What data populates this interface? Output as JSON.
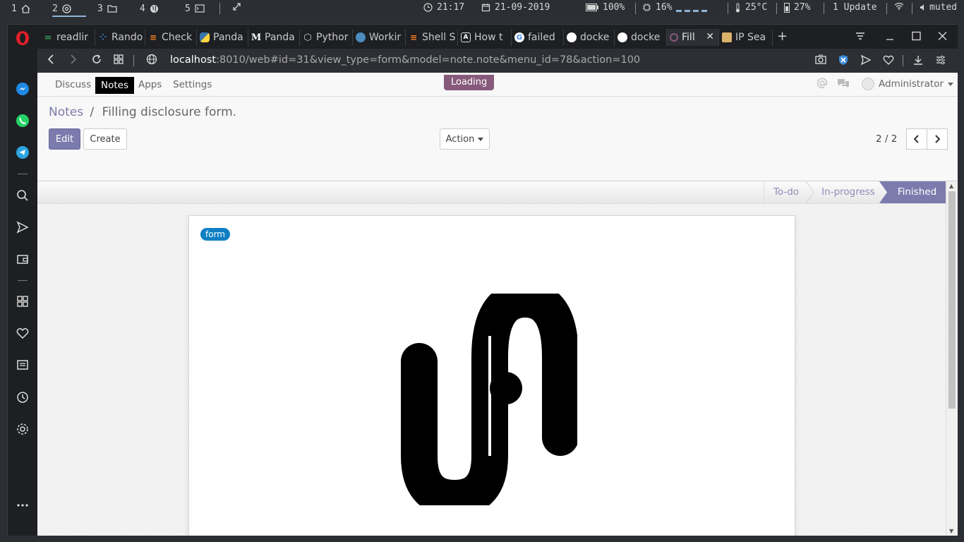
{
  "os_bar": {
    "workspaces": [
      {
        "num": "1",
        "icon": "home-icon"
      },
      {
        "num": "2",
        "icon": "chrome-icon"
      },
      {
        "num": "3",
        "icon": "folder-icon"
      },
      {
        "num": "4",
        "icon": "globe-icon"
      },
      {
        "num": "5",
        "icon": "terminal-icon"
      }
    ],
    "time": "21:17",
    "date": "21-09-2019",
    "battery": "100%",
    "cpu": "16%",
    "temp": "25°C",
    "disk": "27%",
    "updates": "1 Update",
    "volume": "muted"
  },
  "browser": {
    "tabs": [
      {
        "label": "readlir",
        "icon": "infinity-icon",
        "color": "#3a9e59"
      },
      {
        "label": "Rando",
        "icon": "grid-icon",
        "color": "#3c7fd1"
      },
      {
        "label": "Check",
        "icon": "stackoverflow-icon",
        "color": "#f48024"
      },
      {
        "label": "Panda",
        "icon": "python-icon",
        "color": "#f2c94c"
      },
      {
        "label": "Panda",
        "icon": "medium-icon",
        "color": "#ffffff"
      },
      {
        "label": "Pythor",
        "icon": "hexagon-icon",
        "color": "#cccccc"
      },
      {
        "label": "Workir",
        "icon": "python-icon",
        "color": "#4b8bbe"
      },
      {
        "label": "Shell S",
        "icon": "stackoverflow-icon",
        "color": "#f48024"
      },
      {
        "label": "How t",
        "icon": "a-icon",
        "color": "#ffffff"
      },
      {
        "label": "failed",
        "icon": "google-icon",
        "color": "#4285f4"
      },
      {
        "label": "docke",
        "icon": "github-icon",
        "color": "#ffffff"
      },
      {
        "label": "docke",
        "icon": "github-icon",
        "color": "#ffffff"
      },
      {
        "label": "Fill",
        "icon": "odoo-icon",
        "color": "#875a7b"
      },
      {
        "label": "IP Sea",
        "icon": "shield-icon",
        "color": "#d9b36b"
      }
    ],
    "url_host": "localhost",
    "url_rest": ":8010/web#id=31&view_type=form&model=note.note&menu_id=78&action=100"
  },
  "odoo": {
    "menu": [
      "Discuss",
      "Notes",
      "Apps",
      "Settings"
    ],
    "loading": "Loading",
    "user": "Administrator",
    "breadcrumb_parent": "Notes",
    "breadcrumb_sep": "/",
    "breadcrumb_current": "Filling disclosure form.",
    "edit_label": "Edit",
    "create_label": "Create",
    "action_label": "Action",
    "pager": "2 / 2",
    "stages": [
      "To-do",
      "In-progress",
      "Finished"
    ],
    "active_stage": "Finished",
    "tag": "form"
  },
  "colors": {
    "odoo_primary": "#7c7bad",
    "odoo_brand": "#875a7b",
    "tag_blue": "#0e7fc3"
  }
}
